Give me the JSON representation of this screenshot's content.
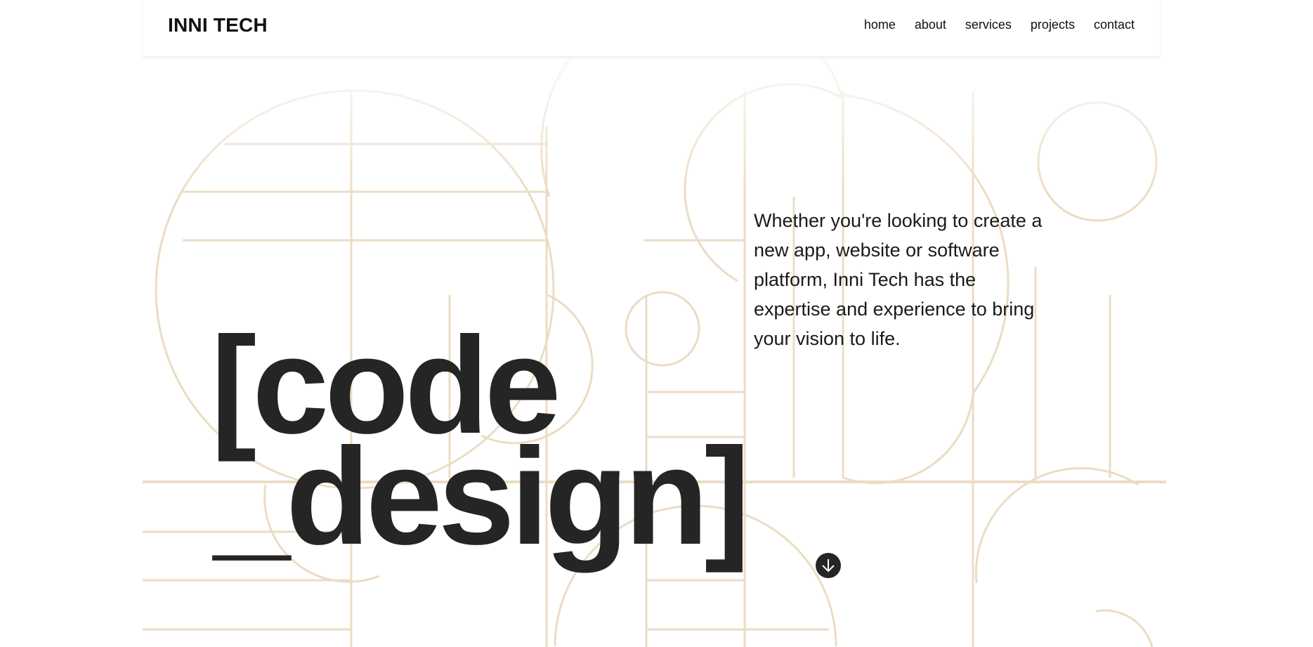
{
  "header": {
    "brand": "INNI TECH",
    "nav": [
      {
        "label": "home"
      },
      {
        "label": "about"
      },
      {
        "label": "services"
      },
      {
        "label": "projects"
      },
      {
        "label": "contact"
      }
    ]
  },
  "hero": {
    "intro": "Whether you're looking to create a new app, website or software platform, Inni Tech has the expertise and experience to bring your vision to life.",
    "headline_line1": "[code",
    "headline_line2": "_design]",
    "scroll_icon": "arrow-down-circle-icon"
  },
  "colors": {
    "text": "#252525",
    "decor": "#ecdcc4",
    "background": "#ffffff"
  }
}
